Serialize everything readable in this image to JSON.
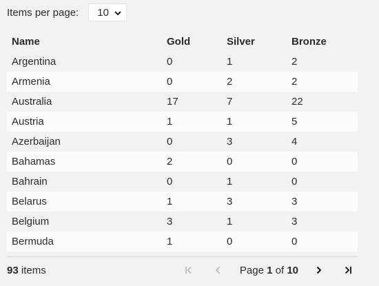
{
  "pager_top": {
    "items_per_page_label": "Items per page:",
    "selected": "10"
  },
  "table": {
    "columns": [
      "Name",
      "Gold",
      "Silver",
      "Bronze"
    ],
    "rows": [
      [
        "Argentina",
        "0",
        "1",
        "2"
      ],
      [
        "Armenia",
        "0",
        "2",
        "2"
      ],
      [
        "Australia",
        "17",
        "7",
        "22"
      ],
      [
        "Austria",
        "1",
        "1",
        "5"
      ],
      [
        "Azerbaijan",
        "0",
        "3",
        "4"
      ],
      [
        "Bahamas",
        "2",
        "0",
        "0"
      ],
      [
        "Bahrain",
        "0",
        "1",
        "0"
      ],
      [
        "Belarus",
        "1",
        "3",
        "3"
      ],
      [
        "Belgium",
        "3",
        "1",
        "3"
      ],
      [
        "Bermuda",
        "1",
        "0",
        "0"
      ]
    ]
  },
  "footer": {
    "item_count": "93",
    "items_word": "items",
    "page_word": "Page",
    "current_page": "1",
    "of_word": "of",
    "total_pages": "10"
  },
  "icons": {
    "first": "first-page-icon",
    "prev": "previous-page-icon",
    "next": "next-page-icon",
    "last": "last-page-icon",
    "dropdown": "chevron-down-icon"
  },
  "colors": {
    "background": "#f2f2f2",
    "row_alt": "#fbfbfb",
    "text": "#2b2b2b",
    "disabled_icon": "#b5b5b5"
  }
}
